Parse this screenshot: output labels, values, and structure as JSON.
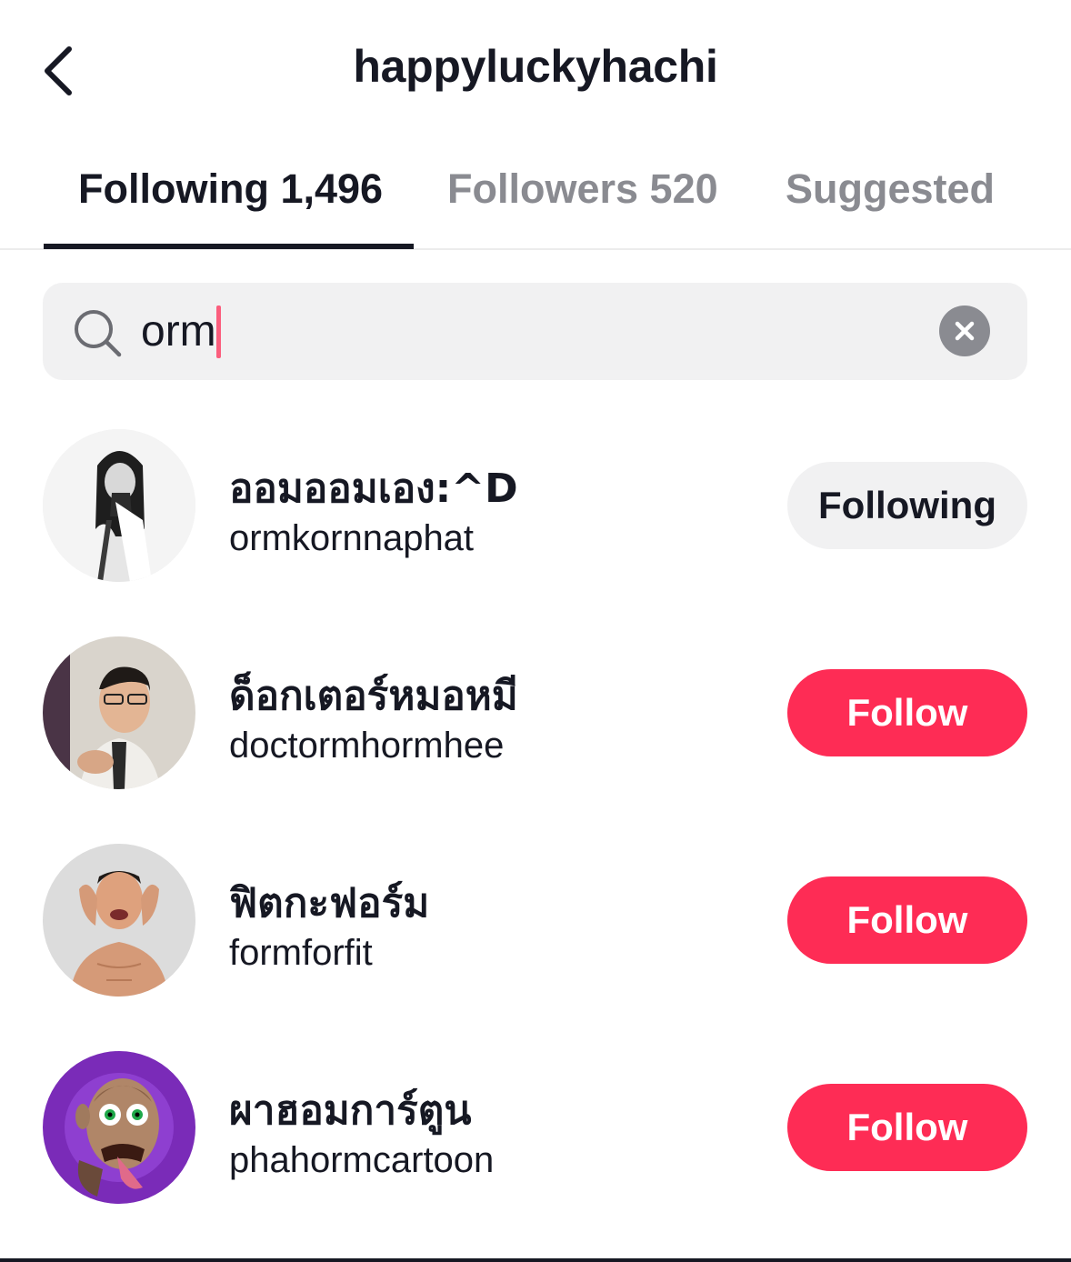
{
  "header": {
    "title": "happyluckyhachi",
    "back_icon": "chevron-left-icon"
  },
  "tabs": [
    {
      "label": "Following 1,496",
      "active": true
    },
    {
      "label": "Followers 520",
      "active": false
    },
    {
      "label": "Suggested",
      "active": false
    }
  ],
  "search": {
    "value": "orm",
    "icon": "search-icon",
    "clear_icon": "clear-icon"
  },
  "users": [
    {
      "display_name": "ออมออมเอง:^D",
      "username": "ormkornnaphat",
      "button_label": "Following",
      "button_state": "following"
    },
    {
      "display_name": "ด็อกเตอร์หมอหมี",
      "username": "doctormhormhee",
      "button_label": "Follow",
      "button_state": "follow"
    },
    {
      "display_name": "ฟิตกะฟอร์ม",
      "username": "formforfit",
      "button_label": "Follow",
      "button_state": "follow"
    },
    {
      "display_name": "ผาฮอมการ์ตูน",
      "username": "phahormcartoon",
      "button_label": "Follow",
      "button_state": "follow"
    }
  ],
  "colors": {
    "accent": "#fe2c55",
    "text": "#161823",
    "muted": "#8a8b91",
    "input_bg": "#f1f1f2"
  }
}
